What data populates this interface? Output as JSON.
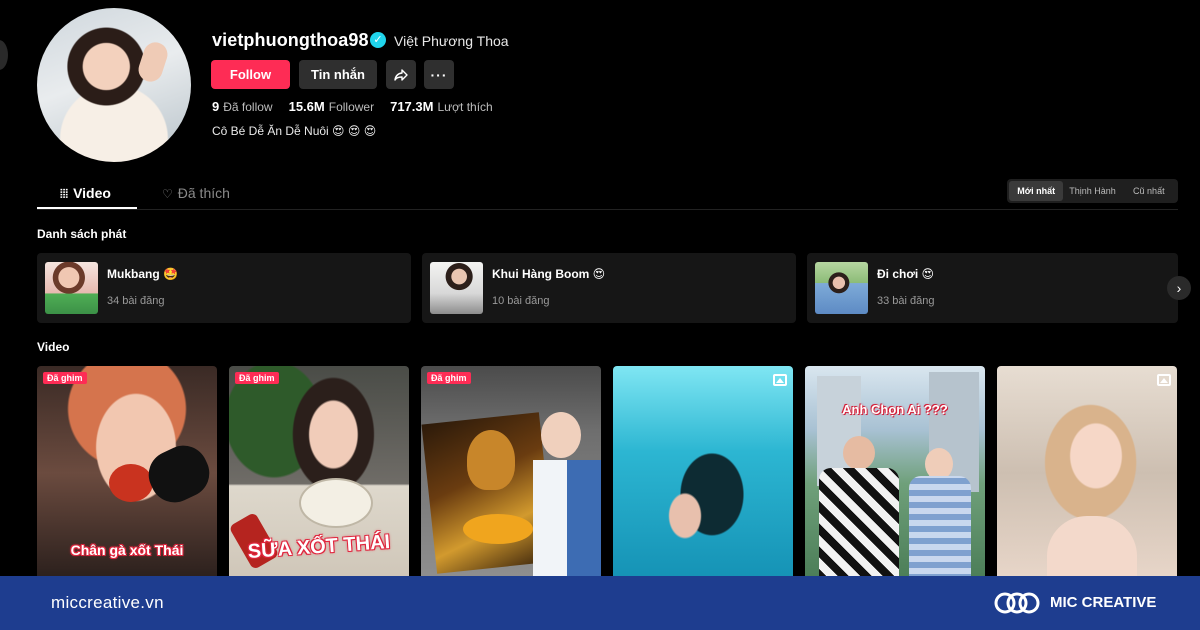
{
  "profile": {
    "username": "vietphuongthoa98",
    "nickname": "Việt Phương Thoa",
    "follow_label": "Follow",
    "message_label": "Tin nhắn",
    "stats": [
      {
        "value": "9",
        "label": "Đã follow"
      },
      {
        "value": "15.6M",
        "label": "Follower"
      },
      {
        "value": "717.3M",
        "label": "Lượt thích"
      }
    ],
    "bio": "Cô Bé Dễ Ăn Dễ Nuôi 😍 😍 😍"
  },
  "tabs": [
    {
      "label": "Video",
      "icon": "grid-icon",
      "active": true
    },
    {
      "label": "Đã thích",
      "icon": "heart-icon",
      "active": false
    }
  ],
  "sort": [
    "Mới nhất",
    "Thịnh Hành",
    "Cũ nhất"
  ],
  "playlists_title": "Danh sách phát",
  "playlists": [
    {
      "title": "Mukbang 🤩",
      "count": "34 bài đăng"
    },
    {
      "title": "Khui Hàng Boom 😍",
      "count": "10 bài đăng"
    },
    {
      "title": "Đi chơi 😍",
      "count": "33 bài đăng"
    }
  ],
  "videos_title": "Video",
  "videos": [
    {
      "badge": "Đã ghim",
      "caption": "Chân gà xốt Thái"
    },
    {
      "badge": "Đã ghim",
      "caption": "SỮA XỐT THÁI"
    },
    {
      "badge": "Đã ghim",
      "caption": ""
    },
    {
      "badge": "",
      "caption": ""
    },
    {
      "badge": "",
      "caption": "Anh Chọn Ai ???"
    },
    {
      "badge": "",
      "caption": ""
    }
  ],
  "footer": {
    "url": "miccreative.vn",
    "brand": "MIC CREATIVE"
  },
  "colors": {
    "accent": "#fe2c55",
    "verified": "#20d5ec",
    "footer_bg": "#1e3d8f"
  }
}
